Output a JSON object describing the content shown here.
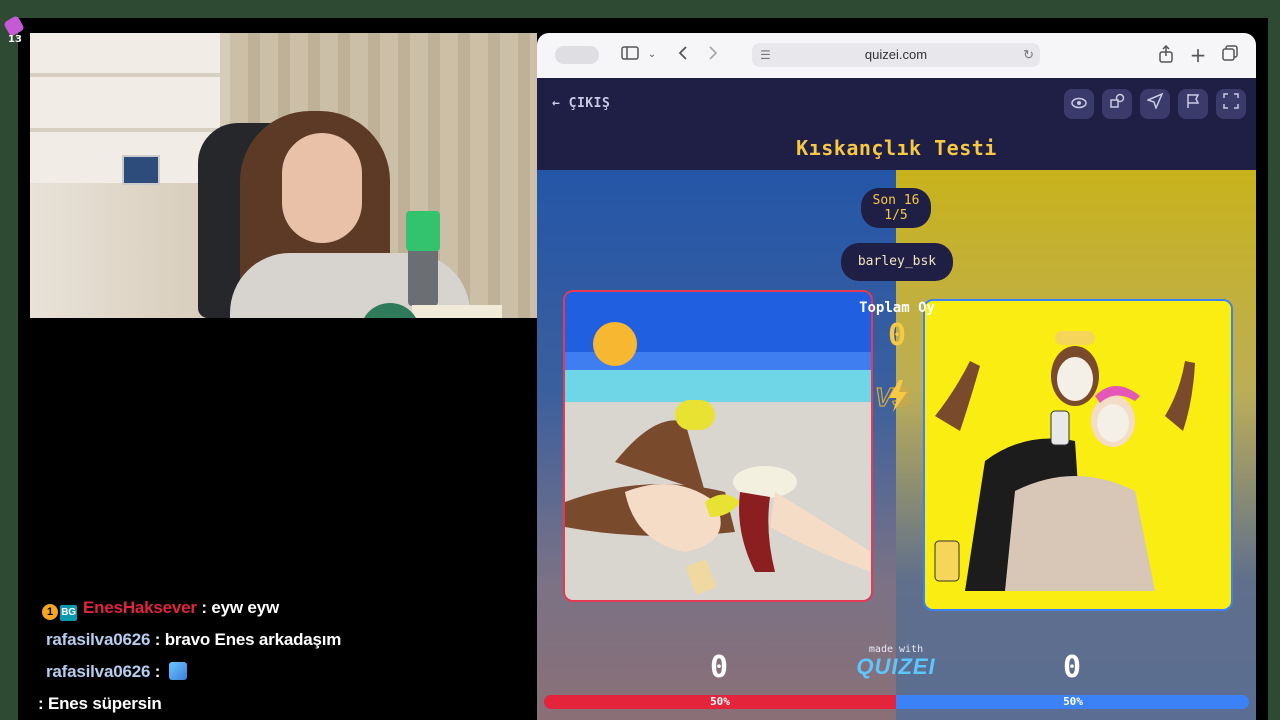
{
  "overlay": {
    "corner_badge": "13"
  },
  "chat": {
    "messages": [
      {
        "badges": [
          "1",
          "BG"
        ],
        "user": "EnesHaksever",
        "text": ": eyw eyw",
        "user_color": "#e0243b"
      },
      {
        "badges": [],
        "user": "rafasilva0626",
        "text": ": bravo Enes arkadaşım",
        "user_color": "#b7cdf0"
      },
      {
        "badges": [],
        "user": "rafasilva0626",
        "text": ": ",
        "emote": "emote",
        "user_color": "#b7cdf0"
      },
      {
        "badges": [],
        "user": "",
        "text": ": Enes süpersin",
        "user_color": "#ffffff"
      }
    ]
  },
  "browser": {
    "url": "quizei.com",
    "icons": [
      "tabs-overview-icon",
      "sidebar-icon",
      "chevron-down-icon",
      "back-icon",
      "forward-icon",
      "share-icon",
      "new-tab-icon",
      "tabs-icon"
    ]
  },
  "quiz": {
    "exit_label": "← ÇIKIŞ",
    "title": "Kıskançlık Testi",
    "round_label": "Son 16",
    "round_progress": "1/5",
    "player": "barley_bsk",
    "total_label": "Toplam Oy",
    "total_value": "0",
    "vs_label": "VS",
    "made_with": "made with",
    "brand": "QUIZEI",
    "left": {
      "score": "0",
      "percent": "50%",
      "share": 0.5,
      "color": "#e3243b"
    },
    "right": {
      "score": "0",
      "percent": "50%",
      "share": 0.5,
      "color": "#3b82f6"
    },
    "toolbar": [
      "eye-icon",
      "shapes-icon",
      "send-icon",
      "flag-icon",
      "fullscreen-icon"
    ]
  }
}
